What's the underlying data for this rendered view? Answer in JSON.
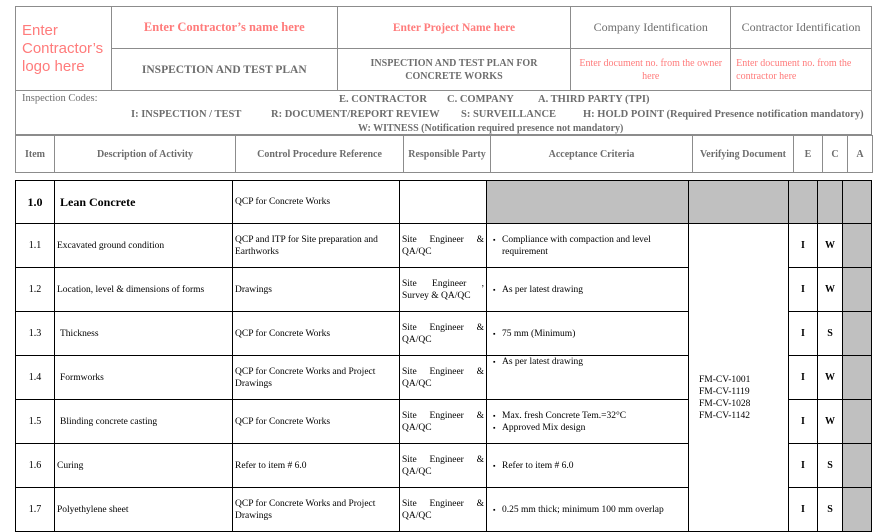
{
  "header": {
    "logo_placeholder": "Enter Contractor’s logo here",
    "contractor_name_placeholder": "Enter Contractor’s name here",
    "plan_title": "INSPECTION AND TEST PLAN",
    "project_name_placeholder": "Enter Project Name here",
    "plan_subtitle": "INSPECTION AND TEST PLAN FOR CONCRETE WORKS",
    "company_id_label": "Company Identification",
    "contractor_id_label": "Contractor Identification",
    "company_doc_placeholder": "Enter document no. from the owner here",
    "contractor_doc_placeholder": "Enter document no. from the contractor here"
  },
  "codes": {
    "label": "Inspection Codes:",
    "parties": [
      "E. CONTRACTOR",
      "C. COMPANY",
      "A. THIRD PARTY (TPI)"
    ],
    "types": [
      "I: INSPECTION / TEST",
      "R: DOCUMENT/REPORT REVIEW",
      "S: SURVEILLANCE",
      "H: HOLD POINT (Required Presence notification mandatory)"
    ],
    "witness": "W: WITNESS (Notification required presence not mandatory)"
  },
  "columns": [
    "Item",
    "Description of Activity",
    "Control Procedure Reference",
    "Responsible Party",
    "Acceptance Criteria",
    "Verifying Document",
    "E",
    "C",
    "A"
  ],
  "section": {
    "item": "1.0",
    "title": "Lean Concrete",
    "procedure": "QCP for Concrete Works"
  },
  "verifying_documents": [
    "FM-CV-1001",
    "FM-CV-1119",
    "FM-CV-1028",
    "FM-CV-1142"
  ],
  "rows": [
    {
      "item": "1.1",
      "activity": "Excavated ground condition",
      "procedure": "QCP and ITP for Site preparation and Earthworks",
      "party": "Site Engineer & QA/QC",
      "criteria": [
        "Compliance with compaction and level requirement"
      ],
      "e": "I",
      "c": "W",
      "a": ""
    },
    {
      "item": "1.2",
      "activity": "Location, level & dimensions of forms",
      "procedure": "Drawings",
      "party": "Site Engineer , Survey & QA/QC",
      "criteria": [
        "As per latest drawing"
      ],
      "e": "I",
      "c": "W",
      "a": ""
    },
    {
      "item": "1.3",
      "activity": "Thickness",
      "procedure": "QCP for Concrete Works",
      "party": "Site Engineer & QA/QC",
      "criteria": [
        "75 mm (Minimum)"
      ],
      "e": "I",
      "c": "S",
      "a": ""
    },
    {
      "item": "1.4",
      "activity": "Formworks",
      "procedure": "QCP for Concrete Works and Project Drawings",
      "party": "Site Engineer & QA/QC",
      "criteria": [
        "As per latest drawing"
      ],
      "e": "I",
      "c": "W",
      "a": ""
    },
    {
      "item": "1.5",
      "activity": "Blinding concrete casting",
      "procedure": "QCP for Concrete Works",
      "party": "Site Engineer & QA/QC",
      "criteria": [
        "Max. fresh Concrete Tem.=32°C",
        "Approved Mix design"
      ],
      "e": "I",
      "c": "W",
      "a": ""
    },
    {
      "item": "1.6",
      "activity": "Curing",
      "procedure": "Refer to item # 6.0",
      "party": "Site Engineer & QA/QC",
      "criteria": [
        "Refer to item # 6.0"
      ],
      "e": "I",
      "c": "S",
      "a": ""
    },
    {
      "item": "1.7",
      "activity": "Polyethylene sheet",
      "procedure": "QCP for Concrete Works and Project Drawings",
      "party": "Site Engineer & QA/QC",
      "criteria": [
        "0.25 mm thick; minimum 100 mm overlap"
      ],
      "e": "I",
      "c": "S",
      "a": ""
    }
  ],
  "colors": {
    "placeholder_text": "#ff7b7b",
    "header_text": "#6d6d6d",
    "shaded_cell": "#c0c0c0"
  }
}
